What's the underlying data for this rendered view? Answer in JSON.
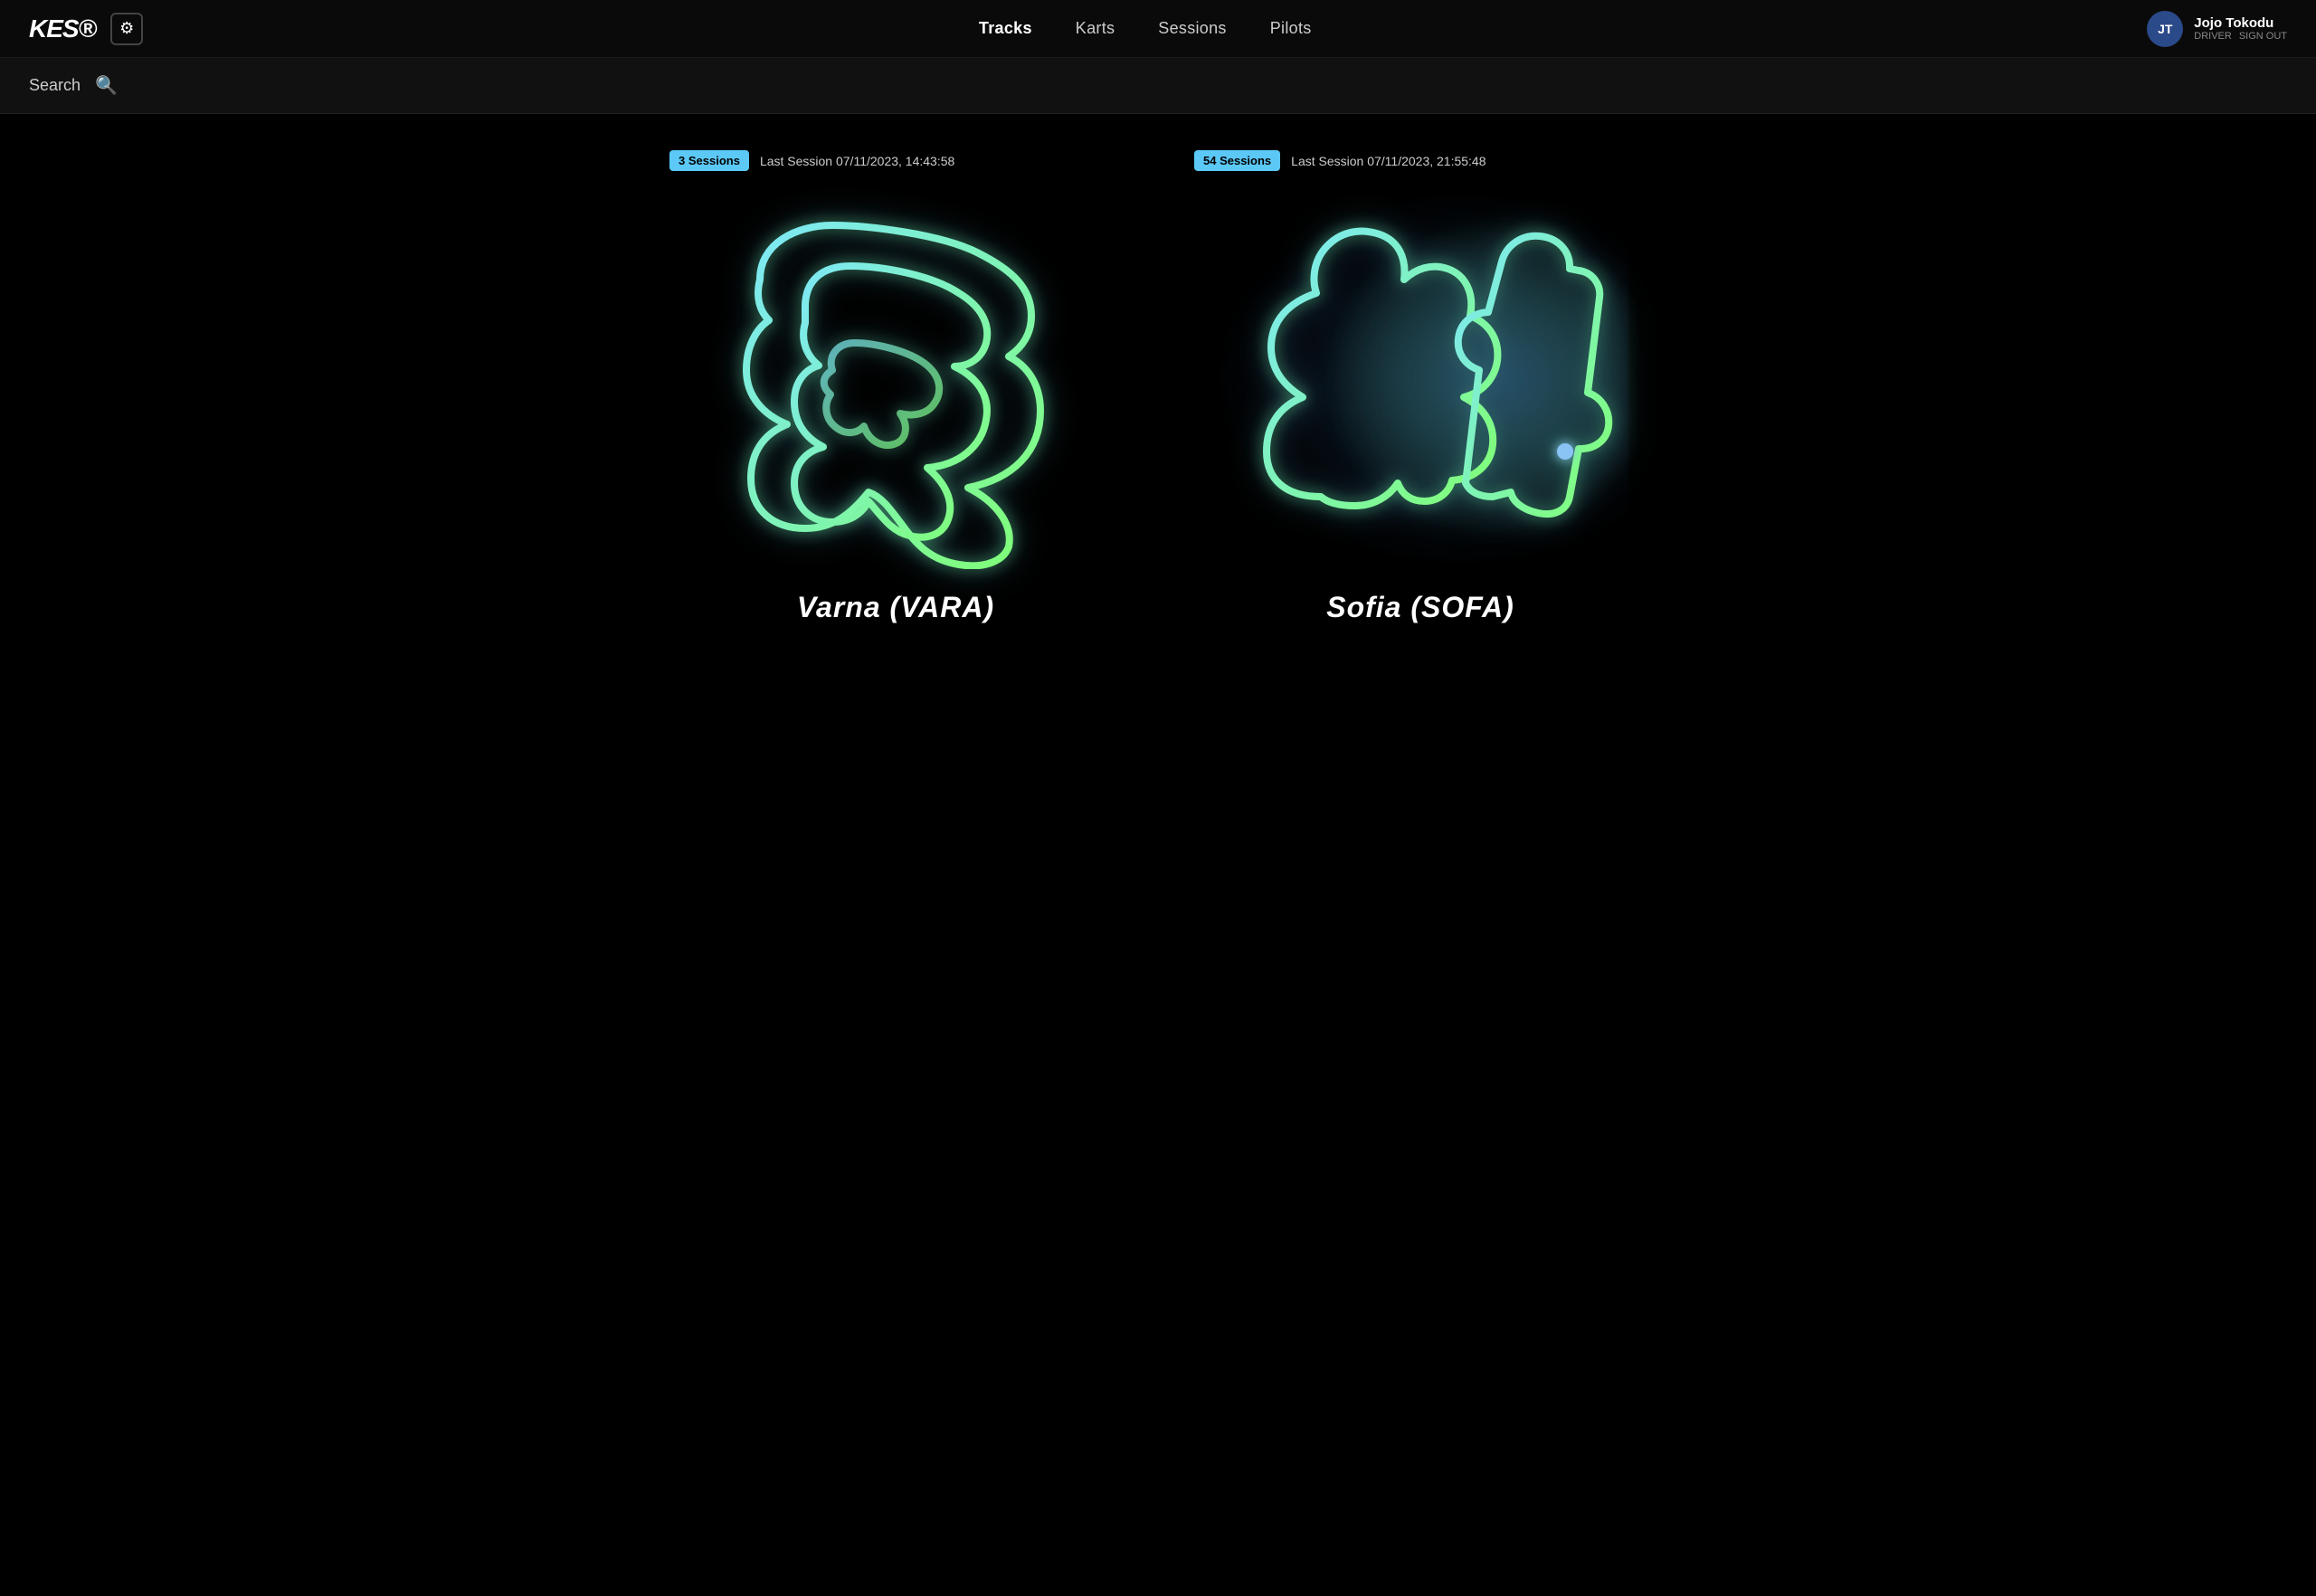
{
  "app": {
    "logo": "KES",
    "logo_suffix": "®"
  },
  "navbar": {
    "gear_icon": "⚙",
    "nav_items": [
      {
        "label": "Tracks",
        "active": true
      },
      {
        "label": "Karts",
        "active": false
      },
      {
        "label": "Sessions",
        "active": false
      },
      {
        "label": "Pilots",
        "active": false
      }
    ],
    "user": {
      "initials": "JT",
      "name": "Jojo Tokodu",
      "role": "DRIVER",
      "sign_out": "SIGN OUT"
    }
  },
  "search": {
    "label": "Search",
    "placeholder": "Search"
  },
  "tracks": [
    {
      "id": "varna",
      "name": "Varna (VARA)",
      "sessions_count": "3 Sessions",
      "last_session": "Last Session 07/11/2023, 14:43:58"
    },
    {
      "id": "sofia",
      "name": "Sofia (SOFA)",
      "sessions_count": "54 Sessions",
      "last_session": "Last Session 07/11/2023, 21:55:48"
    }
  ]
}
